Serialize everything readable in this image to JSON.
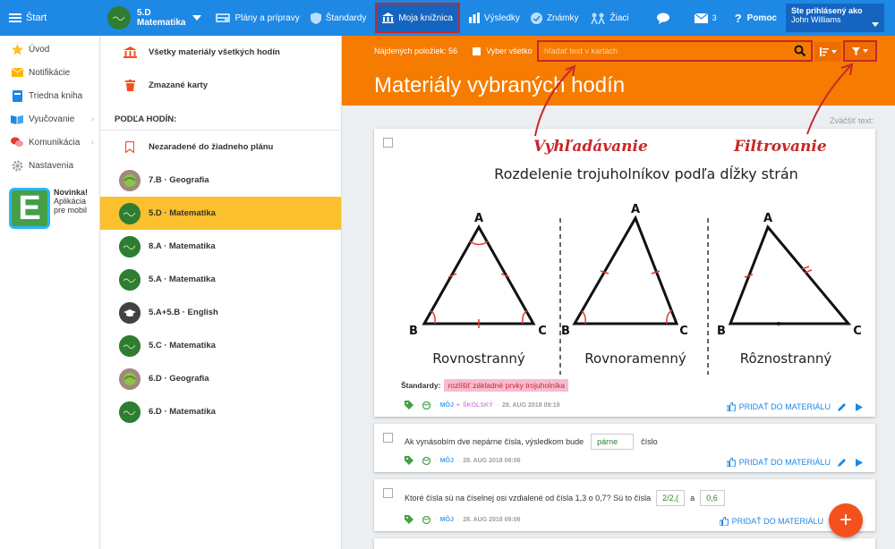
{
  "topbar": {
    "start": "Štart",
    "class_line1": "5.D",
    "class_line2": "Matematika",
    "nav": [
      "Plány a prípravy",
      "Štandardy",
      "Moja knižnica",
      "Výsledky",
      "Známky",
      "Žiaci"
    ],
    "mail_count": "3",
    "help": "Pomoc",
    "user_line1": "Ste prihlásený ako",
    "user_line2": "John Williams"
  },
  "sidebar": {
    "items": [
      "Úvod",
      "Notifikácie",
      "Triedna kniha",
      "Vyučovanie",
      "Komunikácia",
      "Nastavenia"
    ],
    "promo_title": "Novinka!",
    "promo_line1": "Aplikácia",
    "promo_line2": "pre mobil",
    "promo_logo": "E"
  },
  "middle": {
    "top_items": [
      "Všetky materiály všetkých hodín",
      "Zmazané karty"
    ],
    "section_header": "PODĽA HODÍN:",
    "unassigned": "Nezaradené do žiadneho plánu",
    "lessons": [
      "7.B · Geografia",
      "5.D · Matematika",
      "8.A · Matematika",
      "5.A · Matematika",
      "5.A+5.B · English",
      "5.C · Matematika",
      "6.D · Geografia",
      "6.D · Matematika"
    ]
  },
  "main": {
    "found": "Nájdených položiek: 56",
    "select_all": "Vyber všetko",
    "search_placeholder": "hľadať text v kartách",
    "title": "Materiály vybraných hodín",
    "zoom": "Zväčšiť text:",
    "annot_search": "Vyhľadávanie",
    "annot_filter": "Filtrovanie",
    "card1": {
      "image_title": "Rozdelenie trojuholníkov podľa dĺžky strán",
      "labels": [
        "Rovnostranný",
        "Rovnoramenný",
        "Rôznostranný"
      ],
      "vertex_a": "A",
      "vertex_b": "B",
      "vertex_c": "C",
      "standards_label": "Štandardy:",
      "standards_tag": "rozlíšiť základné prvky trojuholníka",
      "meta_moj": "MÔJ",
      "meta_plus": "+",
      "meta_skolsky": "ŠKOLSKÝ",
      "meta_date": "28. AUG 2018 09:19"
    },
    "card2": {
      "text_before": "Ak vynásobím dve nepárne čísla, výsledkom bude",
      "blank": "párne",
      "text_after": "číslo",
      "meta_moj": "MÔJ",
      "meta_date": "28. AUG 2018 09:06"
    },
    "card3": {
      "text_before": "Ktoré čísla sú na číselnej osi vzdialené od čísla 1,3 o 0,7? Sú to čísla",
      "blank1": "2/2,(",
      "text_mid": "a",
      "blank2": "0,6",
      "meta_moj": "MÔJ",
      "meta_date": "28. AUG 2018 09:06"
    },
    "add_label": "PRIDAŤ DO MATERIÁLU",
    "fab": "+"
  },
  "colors": {
    "topbar": "#1e88e5",
    "orange": "#f57c00",
    "active": "#fbc02d",
    "annotation": "#c62828"
  }
}
